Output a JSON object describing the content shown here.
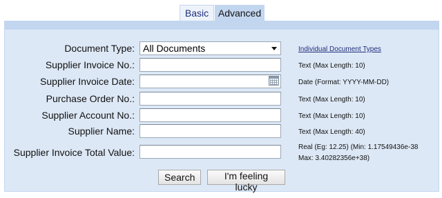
{
  "tabs": {
    "basic": "Basic",
    "advanced": "Advanced"
  },
  "form": {
    "document_type": {
      "label": "Document Type:",
      "value": "All Documents",
      "hint_link": "Individual Document Types"
    },
    "supplier_invoice_no": {
      "label": "Supplier Invoice No.:",
      "value": "",
      "hint": "Text (Max Length: 10)"
    },
    "supplier_invoice_date": {
      "label": "Supplier Invoice Date:",
      "value": "",
      "hint": "Date (Format: YYYY-MM-DD)"
    },
    "purchase_order_no": {
      "label": "Purchase Order No.:",
      "value": "",
      "hint": "Text (Max Length: 10)"
    },
    "supplier_account_no": {
      "label": "Supplier Account No.:",
      "value": "",
      "hint": "Text (Max Length: 10)"
    },
    "supplier_name": {
      "label": "Supplier Name:",
      "value": "",
      "hint": "Text (Max Length: 40)"
    },
    "supplier_invoice_total_value": {
      "label": "Supplier Invoice Total Value:",
      "value": "",
      "hint_line1": "Real (Eg: 12.25) (Min: 1.17549436e-38",
      "hint_line2": "Max: 3.40282356e+38)"
    }
  },
  "buttons": {
    "search": "Search",
    "lucky": "I'm feeling lucky"
  },
  "icons": {
    "calendar": "calendar-icon",
    "dropdown": "chevron-down-icon"
  },
  "colors": {
    "panel_background": "#dde8f6",
    "panel_bar": "#c3d6f0",
    "link": "#1f2e7a"
  }
}
